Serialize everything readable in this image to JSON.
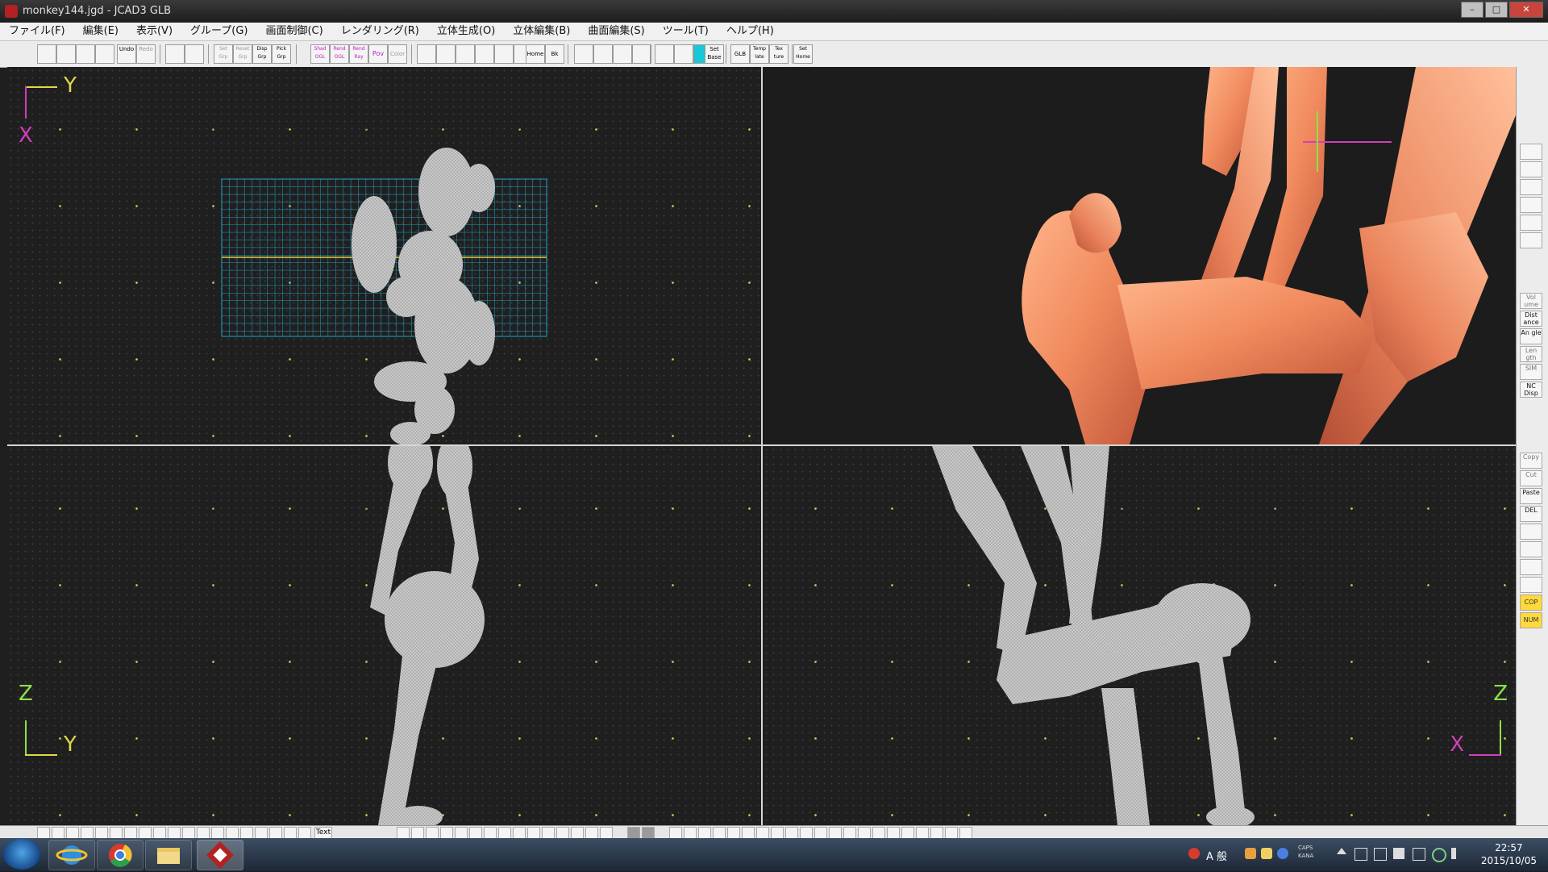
{
  "window": {
    "title": "monkey144.jgd - JCAD3 GLB",
    "buttons": [
      "–",
      "□",
      "✕"
    ]
  },
  "menu": [
    "ファイル(F)",
    "編集(E)",
    "表示(V)",
    "グループ(G)",
    "画面制御(C)",
    "レンダリング(R)",
    "立体生成(O)",
    "立体編集(B)",
    "曲面編集(S)",
    "ツール(T)",
    "ヘルプ(H)"
  ],
  "toolbar": {
    "labels": [
      "Undo",
      "Redo",
      "Set Grp",
      "Reset Grp",
      "Disp Grp",
      "Pick Grp",
      "Shad OGL",
      "Rend OGL",
      "Rend Ray",
      "Pov",
      "Color",
      "Home",
      "Bk",
      "Set Base",
      "GLB",
      "Temp late",
      "Tex ture",
      "Set Home"
    ]
  },
  "viewports": {
    "top_left": {
      "axis_v": "Y",
      "axis_h": "X"
    },
    "bottom_left": {
      "axis_v": "Z",
      "axis_h": "Y"
    },
    "bottom_right": {
      "axis_v": "Z",
      "axis_h": "X"
    }
  },
  "sidebar": {
    "buttons": [
      "Vol ume",
      "Dist ance",
      "An gle",
      "Len gth",
      "SIM",
      "NC Disp",
      "Copy",
      "Cut",
      "Paste",
      "DEL"
    ],
    "status": [
      "COP",
      "NUM"
    ]
  },
  "bottom_toolbar": {
    "text_label": "Text"
  },
  "taskbar": {
    "ime": "A 般",
    "caps": "CAPS",
    "kana": "KANA",
    "time": "22:57",
    "date": "2015/10/05"
  },
  "colors": {
    "grid_lines": "#1fa3c9",
    "model_render": "#f08a5d",
    "mesh": "#cfcfcf",
    "axis_y": "#e0d84a",
    "axis_x": "#d13fb8",
    "axis_z": "#8ee04a"
  }
}
